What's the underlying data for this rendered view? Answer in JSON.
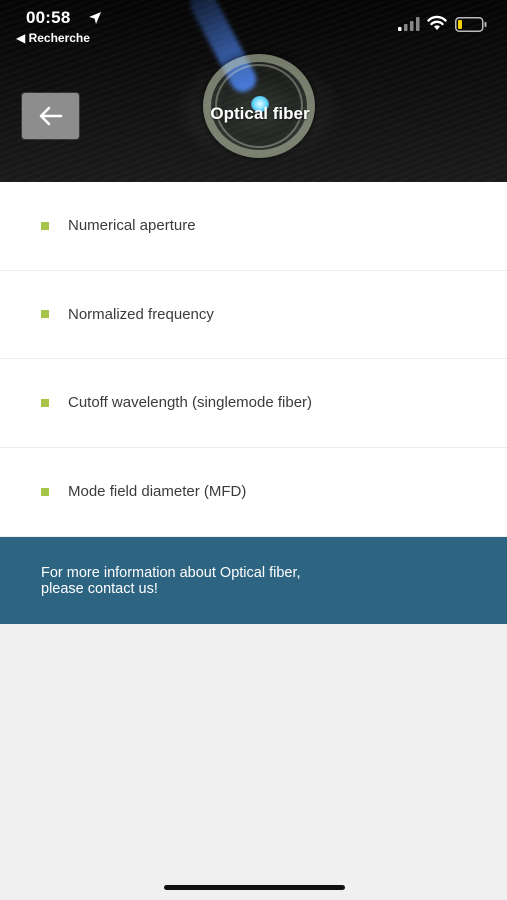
{
  "status_bar": {
    "time": "00:58",
    "back_app": "◀ Recherche",
    "icons": [
      "location-arrow-icon",
      "cellular-signal-icon",
      "wifi-icon",
      "battery-icon"
    ]
  },
  "header": {
    "title": "Optical fiber",
    "back_icon": "arrow-left-icon"
  },
  "list": {
    "items": [
      {
        "label": "Numerical aperture"
      },
      {
        "label": "Normalized frequency"
      },
      {
        "label": "Cutoff wavelength (singlemode fiber)"
      },
      {
        "label": "Mode field diameter (MFD)"
      }
    ]
  },
  "banner": {
    "text": "For more information about Optical fiber, please contact us!"
  },
  "colors": {
    "bullet": "#a6c44a",
    "banner": "#2d6481",
    "background": "#f0f0f1"
  }
}
